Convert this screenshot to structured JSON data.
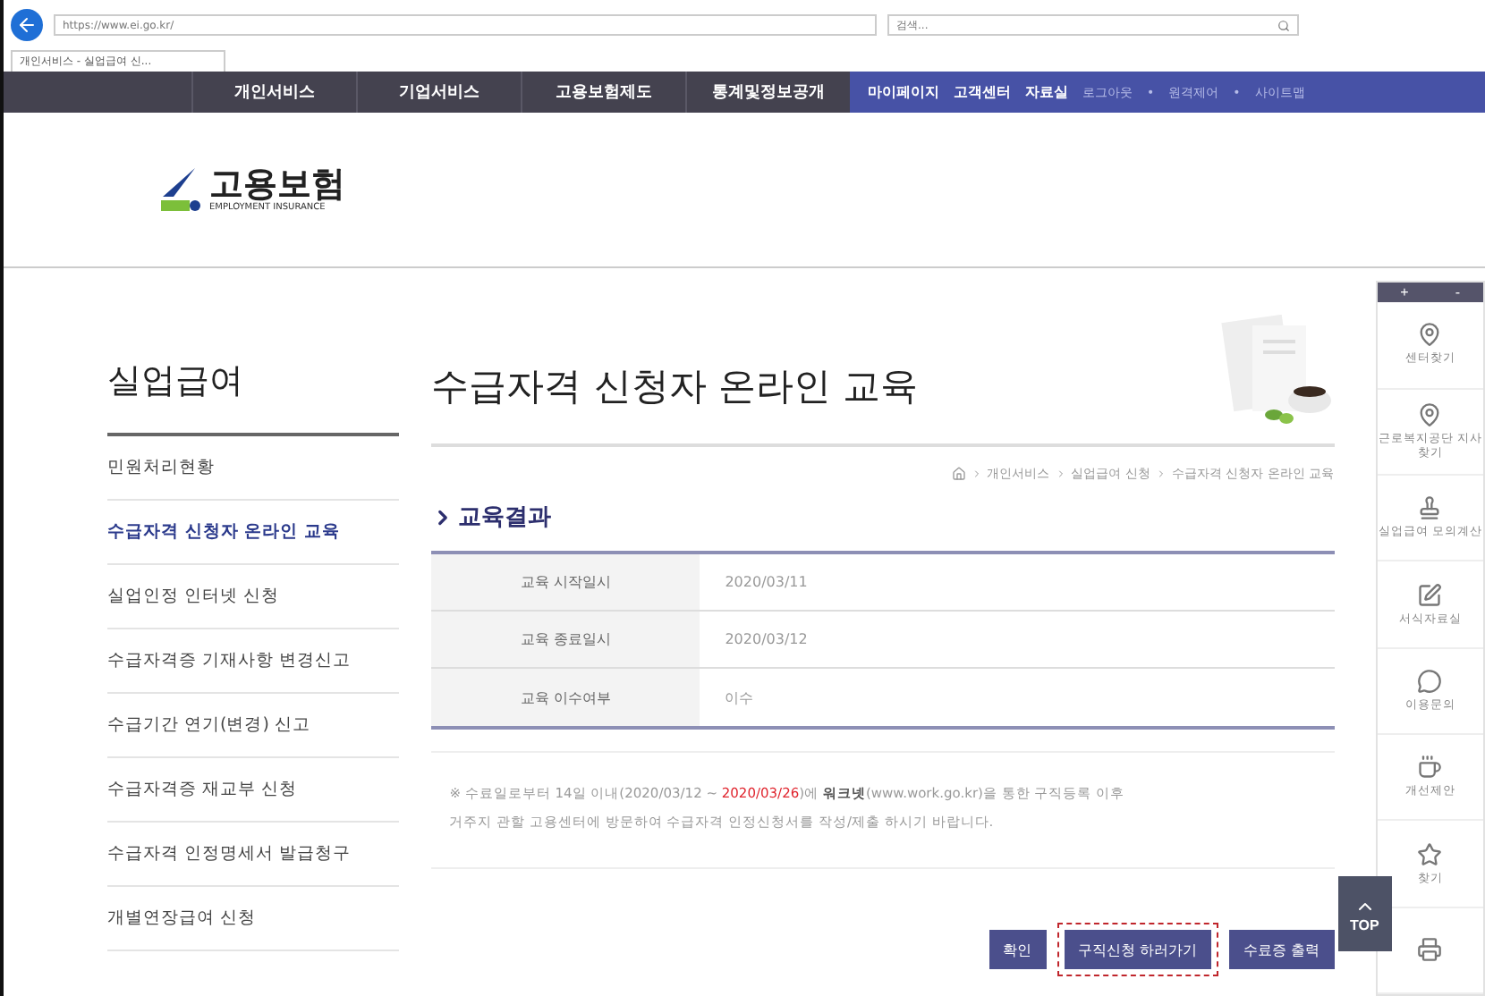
{
  "browser": {
    "address": "https://www.ei.go.kr/",
    "search_placeholder": "검색...",
    "tab_title": "개인서비스 - 실업급여 신..."
  },
  "nav": {
    "main": [
      "개인서비스",
      "기업서비스",
      "고용보험제도",
      "통계및정보공개"
    ],
    "utility": [
      "마이페이지",
      "고객센터",
      "자료실"
    ],
    "links": [
      "로그아웃",
      "원격제어",
      "사이트맵"
    ],
    "separator": "•"
  },
  "logo": {
    "name": "고용보험",
    "subtitle": "EMPLOYMENT INSURANCE"
  },
  "sidebar": {
    "title": "실업급여",
    "items": [
      {
        "label": "민원처리현황",
        "selected": false
      },
      {
        "label": "수급자격 신청자 온라인 교육",
        "selected": true
      },
      {
        "label": "실업인정 인터넷 신청",
        "selected": false
      },
      {
        "label": "수급자격증 기재사항 변경신고",
        "selected": false
      },
      {
        "label": "수급기간 연기(변경) 신고",
        "selected": false
      },
      {
        "label": "수급자격증 재교부 신청",
        "selected": false
      },
      {
        "label": "수급자격 인정명세서 발급청구",
        "selected": false
      },
      {
        "label": "개별연장급여 신청",
        "selected": false
      }
    ]
  },
  "page": {
    "title": "수급자격 신청자 온라인 교육",
    "breadcrumb": [
      "개인서비스",
      "실업급여 신청",
      "수급자격 신청자 온라인 교육"
    ],
    "section": "교육결과",
    "rows": [
      {
        "label": "교육 시작일시",
        "value": "2020/03/11"
      },
      {
        "label": "교육 종료일시",
        "value": "2020/03/12"
      },
      {
        "label": "교육 이수여부",
        "value": "이수"
      }
    ],
    "note_lines": [
      [
        {
          "text": "※ 수료일로부터 14일 이내(2020/03/12 ~ ",
          "kind": "plain"
        },
        {
          "text": "2020/03/26",
          "kind": "alert"
        },
        {
          "text": ")에 ",
          "kind": "plain"
        },
        {
          "text": "워크넷",
          "kind": "bold"
        },
        {
          "text": "(www.work.go.kr)을 통한 구직등록 이후",
          "kind": "plain"
        }
      ],
      [
        {
          "text": "거주지 관할 고용센터에 방문하여 수급자격 인정신청서를 작성/제출 하시기 바랍니다.",
          "kind": "plain"
        }
      ]
    ],
    "buttons": [
      {
        "label": "확인",
        "highlighted": false
      },
      {
        "label": "구직신청 하러가기",
        "highlighted": true
      },
      {
        "label": "수료증 출력",
        "highlighted": false
      }
    ]
  },
  "quick_menu": {
    "controls": [
      "+",
      "-"
    ],
    "items": [
      {
        "label": "센터찾기",
        "kind": "pin"
      },
      {
        "label": "근로복지공단 지사찾기",
        "kind": "pin"
      },
      {
        "label": "실업급여 모의계산",
        "kind": "stamp"
      },
      {
        "label": "서식자료실",
        "kind": "pen"
      },
      {
        "label": "이용문의",
        "kind": "chat"
      },
      {
        "label": "개선제안",
        "kind": "coffee"
      },
      {
        "label": "찾기",
        "kind": "star"
      },
      {
        "kind": "printer"
      }
    ],
    "top": "TOP"
  }
}
